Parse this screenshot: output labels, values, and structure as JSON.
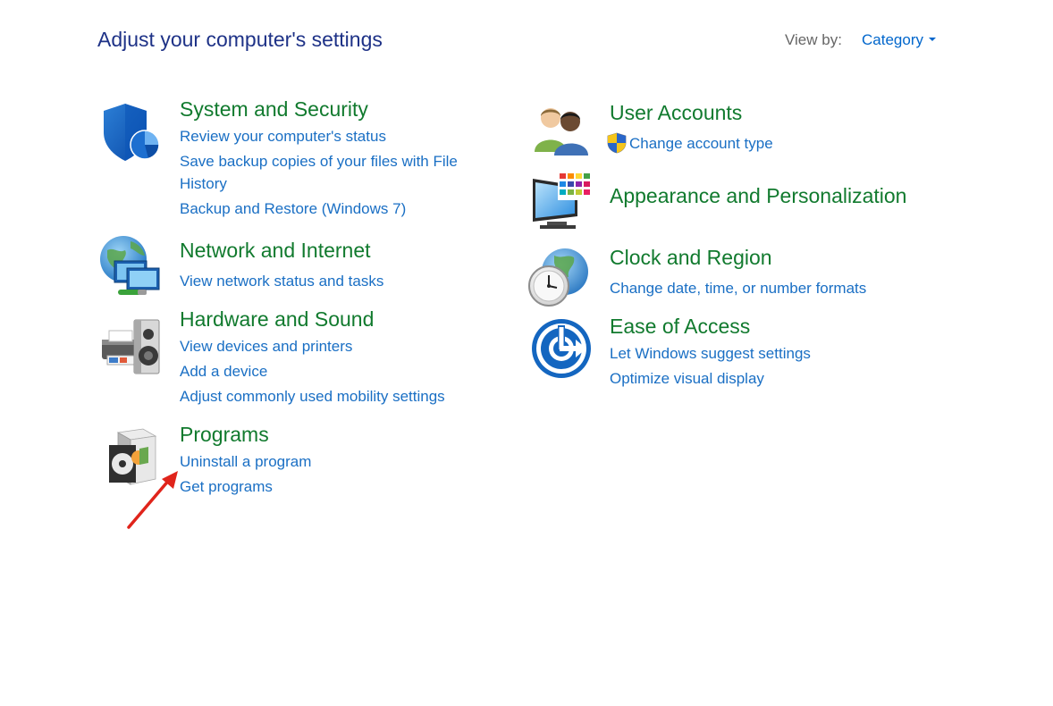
{
  "header": {
    "title": "Adjust your computer's settings",
    "view_by_label": "View by:",
    "view_by_value": "Category"
  },
  "categories": {
    "system_security": {
      "title": "System and Security",
      "icon": "shield-icon",
      "links": [
        "Review your computer's status",
        "Save backup copies of your files with File",
        "History",
        "Backup and Restore (Windows 7)"
      ]
    },
    "network_internet": {
      "title": "Network and Internet",
      "icon": "network-globe-icon",
      "links": [
        "View network status and tasks"
      ]
    },
    "hardware_sound": {
      "title": "Hardware and Sound",
      "icon": "printer-speaker-icon",
      "links": [
        "View devices and printers",
        "Add a device",
        "Adjust commonly used mobility settings"
      ]
    },
    "programs": {
      "title": "Programs",
      "icon": "programs-box-icon",
      "links": [
        "Uninstall a program",
        "Get programs"
      ]
    },
    "user_accounts": {
      "title": "User Accounts",
      "icon": "users-icon",
      "links": [
        "Change account type"
      ],
      "link_icon": "uac-shield-icon"
    },
    "appearance": {
      "title": "Appearance and Personalization",
      "icon": "monitor-palette-icon",
      "links": []
    },
    "clock_region": {
      "title": "Clock and Region",
      "icon": "clock-globe-icon",
      "links": [
        "Change date, time, or number formats"
      ]
    },
    "ease_access": {
      "title": "Ease of Access",
      "icon": "ease-of-access-icon",
      "links": [
        "Let Windows suggest settings",
        "Optimize visual display"
      ]
    }
  },
  "colors": {
    "title_blue": "#1e3287",
    "category_green": "#117a2e",
    "link_blue": "#1a6fc4",
    "annotation_red": "#e0241b"
  },
  "annotation": {
    "type": "arrow",
    "color": "#e0241b",
    "points_to": "Uninstall a program"
  }
}
